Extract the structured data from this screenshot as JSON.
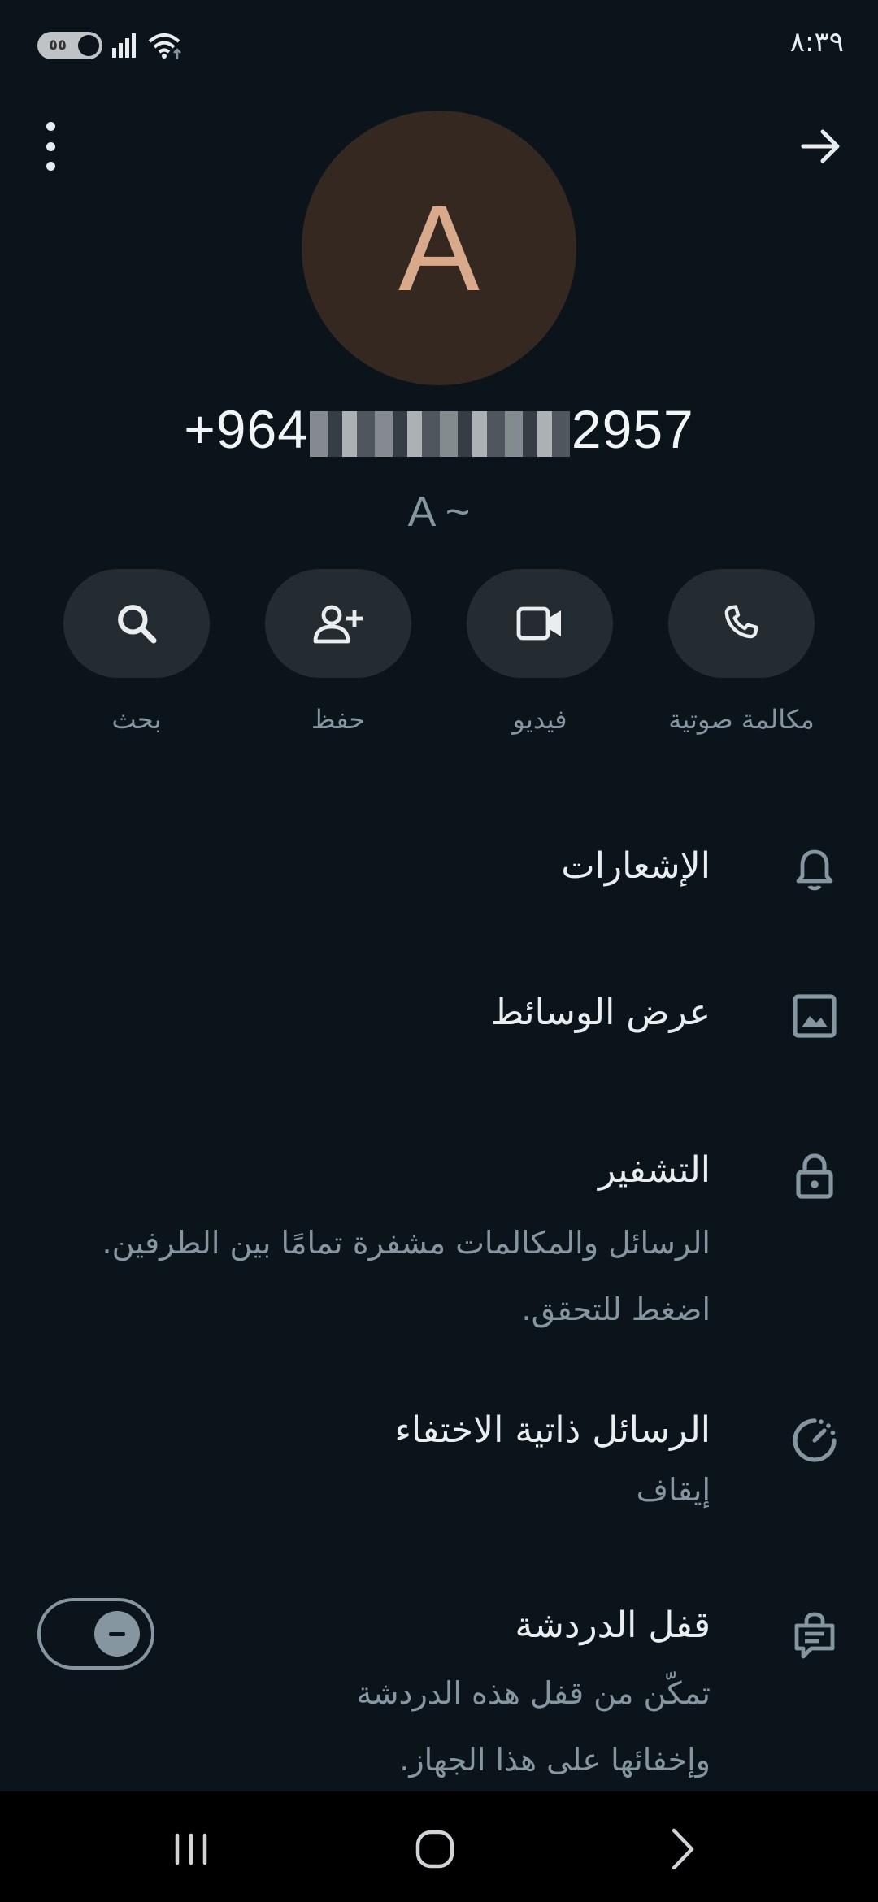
{
  "status_bar": {
    "time": "٨:٣٩",
    "toggle_text": "٥٥"
  },
  "contact": {
    "avatar_letter": "A",
    "phone_prefix": "+964",
    "phone_suffix": "2957",
    "push_name": "A ~"
  },
  "actions": [
    {
      "label": "مكالمة صوتية",
      "icon": "phone-icon"
    },
    {
      "label": "فيديو",
      "icon": "video-icon"
    },
    {
      "label": "حفظ",
      "icon": "add-contact-icon"
    },
    {
      "label": "بحث",
      "icon": "search-icon"
    }
  ],
  "settings": {
    "notifications": {
      "title": "الإشعارات",
      "icon": "bell-icon"
    },
    "media": {
      "title": "عرض الوسائط",
      "icon": "image-icon"
    },
    "encryption": {
      "title": "التشفير",
      "line1": "الرسائل والمكالمات مشفرة تمامًا بين الطرفين.",
      "line2": "اضغط للتحقق.",
      "icon": "lock-icon"
    },
    "disappearing": {
      "title": "الرسائل ذاتية الاختفاء",
      "value": "إيقاف",
      "icon": "timer-icon"
    },
    "chat_lock": {
      "title": "قفل الدردشة",
      "line1": "تمكّن من قفل هذه الدردشة",
      "line2": "وإخفائها على هذا الجهاز.",
      "icon": "chat-lock-icon",
      "enabled": false
    }
  },
  "colors": {
    "background": "#0b141a",
    "button_bg": "#252c31",
    "secondary_text": "#8696a0",
    "avatar_bg": "#352821",
    "avatar_letter": "#d9a98b"
  }
}
